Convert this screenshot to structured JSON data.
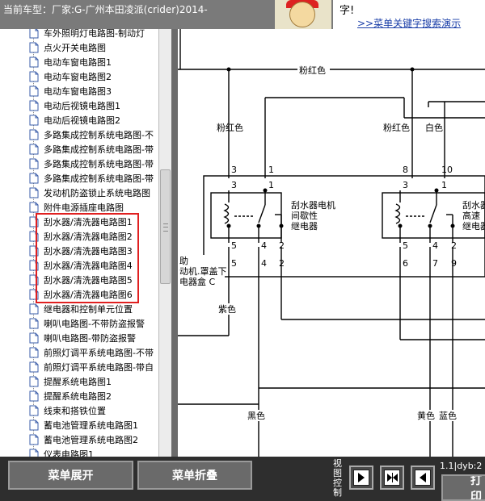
{
  "header": {
    "car_model": "当前车型：厂家:G-广州本田凌派(crider)2014-",
    "tip_fragment": "字!",
    "tip_link": ">>菜单关键字搜索演示"
  },
  "tree": {
    "items": [
      "车外照明灯电路图-制动灯",
      "点火开关电路图",
      "电动车窗电路图1",
      "电动车窗电路图2",
      "电动车窗电路图3",
      "电动后视镜电路图1",
      "电动后视镜电路图2",
      "多路集成控制系统电路图-不",
      "多路集成控制系统电路图-带",
      "多路集成控制系统电路图-带",
      "多路集成控制系统电路图-带",
      "发动机防盗锁止系统电路图",
      "附件电源插座电路图",
      "刮水器/清洗器电路图1",
      "刮水器/清洗器电路图2",
      "刮水器/清洗器电路图3",
      "刮水器/清洗器电路图4",
      "刮水器/清洗器电路图5",
      "刮水器/清洗器电路图6",
      "继电器和控制单元位置",
      "喇叭电路图-不带防盗报警",
      "喇叭电路图-带防盗报警",
      "前照灯调平系统电路图-不带",
      "前照灯调平系统电路图-带自",
      "提醒系统电路图1",
      "提醒系统电路图2",
      "线束和搭铁位置",
      "蓄电池管理系统电路图1",
      "蓄电池管理系统电路图2",
      "仪表电路图1"
    ]
  },
  "diagram": {
    "wire_pink_top": "粉红色",
    "wire_pink_left": "粉红色",
    "wire_pink_right": "粉红色",
    "wire_white": "白色",
    "relay1_label": [
      "刮水器电机",
      "间歇性",
      "继电器"
    ],
    "relay2_label": [
      "刮水器",
      "高速",
      "继电器"
    ],
    "box_label": [
      "助",
      "动机.罩盖下",
      "电器盒 C"
    ],
    "wire_purple": "紫色",
    "wire_black": "黑色",
    "wire_yellow": "黄色",
    "wire_blue": "蓝色",
    "pins": {
      "r1_top_outer": [
        "3",
        "1"
      ],
      "r1_top_inner": [
        "3",
        "1"
      ],
      "r1_bottom_inner": [
        "5",
        "4",
        "2"
      ],
      "r1_bottom_outer": [
        "5",
        "4",
        "2"
      ],
      "r2_top_outer": [
        "8",
        "10"
      ],
      "r2_top_inner": [
        "3",
        "1"
      ],
      "r2_bottom_inner": [
        "5",
        "4",
        "2"
      ],
      "r2_bottom_outer": [
        "6",
        "7",
        "9"
      ]
    }
  },
  "bottom": {
    "expand_label": "菜单展开",
    "collapse_label": "菜单折叠",
    "view_control_label": "视图控制",
    "status_text": "1.1|dyb:2",
    "print_label": "打印"
  }
}
